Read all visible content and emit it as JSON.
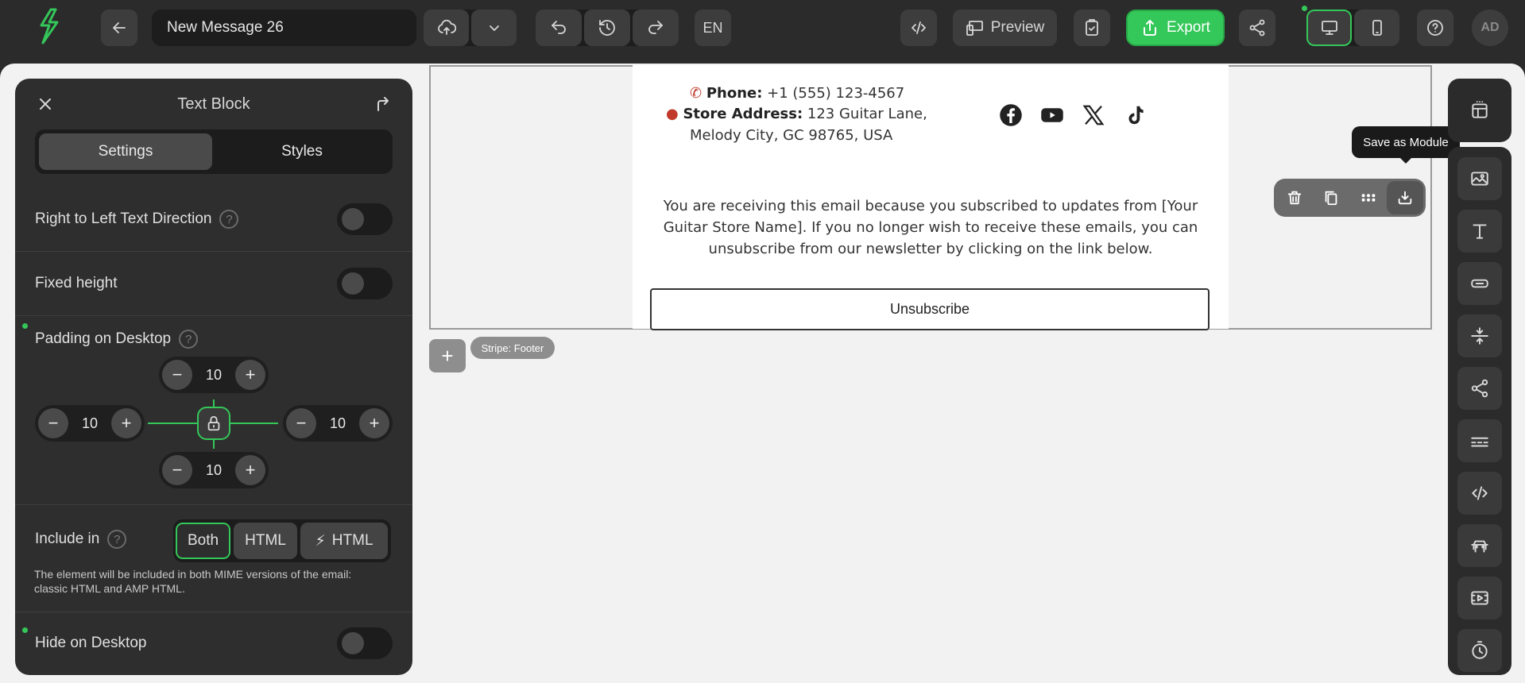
{
  "app": {
    "message_name": "New Message 26",
    "language": "EN"
  },
  "toolbar": {
    "preview_label": "Preview",
    "export_label": "Export",
    "avatar_initials": "AD"
  },
  "panel": {
    "title": "Text Block",
    "tabs": [
      "Settings",
      "Styles"
    ],
    "rtl_label": "Right to Left Text Direction",
    "fixed_height_label": "Fixed height",
    "padding_label": "Padding on Desktop",
    "padding": {
      "top": "10",
      "left": "10",
      "right": "10",
      "bottom": "10"
    },
    "include_label": "Include in",
    "include_options": [
      "Both",
      "HTML",
      "HTML"
    ],
    "include_note": "The element will be included in both MIME versions of the email: classic HTML and AMP HTML.",
    "hide_label": "Hide on Desktop",
    "help_glyph": "?"
  },
  "email": {
    "phone_label": "Phone:",
    "phone_value": "+1 (555) 123-4567",
    "address_label": "Store Address:",
    "address_line1": "123 Guitar Lane,",
    "address_line2": "Melody City, GC 98765, USA",
    "subscription_text": "You are receiving this email because you subscribed to updates from [Your Guitar Store Name]. If you no longer wish to receive these emails, you can unsubscribe from our newsletter by clicking on the link below.",
    "unsubscribe_label": "Unsubscribe"
  },
  "stripe": {
    "label": "Stripe: Footer",
    "add_glyph": "+"
  },
  "tooltip": {
    "text": "Save as Module"
  },
  "colors": {
    "accent": "#34c759",
    "dark": "#2b2b2b",
    "canvas": "#f2f2f2"
  }
}
